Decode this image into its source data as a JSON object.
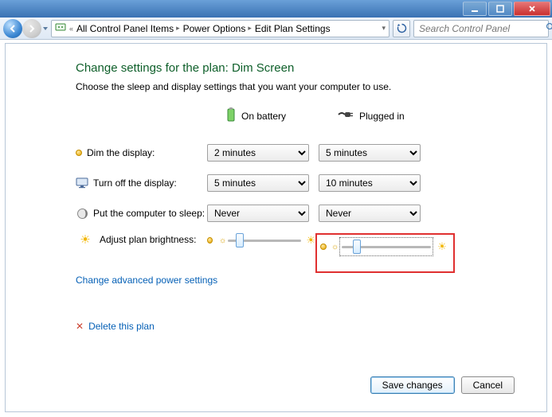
{
  "window": {
    "min": "_",
    "max": "□",
    "close": "×"
  },
  "breadcrumb": {
    "item1": "All Control Panel Items",
    "item2": "Power Options",
    "item3": "Edit Plan Settings"
  },
  "search": {
    "placeholder": "Search Control Panel"
  },
  "page": {
    "title": "Change settings for the plan: Dim Screen",
    "subtitle": "Choose the sleep and display settings that you want your computer to use."
  },
  "columns": {
    "battery": "On battery",
    "plugged": "Plugged in"
  },
  "rows": {
    "dim": {
      "label": "Dim the display:",
      "battery": "2 minutes",
      "plugged": "5 minutes"
    },
    "off": {
      "label": "Turn off the display:",
      "battery": "5 minutes",
      "plugged": "10 minutes"
    },
    "sleep": {
      "label": "Put the computer to sleep:",
      "battery": "Never",
      "plugged": "Never"
    },
    "bright": {
      "label": "Adjust plan brightness:"
    }
  },
  "links": {
    "advanced": "Change advanced power settings",
    "delete": "Delete this plan"
  },
  "buttons": {
    "save": "Save changes",
    "cancel": "Cancel"
  },
  "colors": {
    "title": "#0e5f2a",
    "link": "#0560b6",
    "highlight": "#e03030"
  }
}
